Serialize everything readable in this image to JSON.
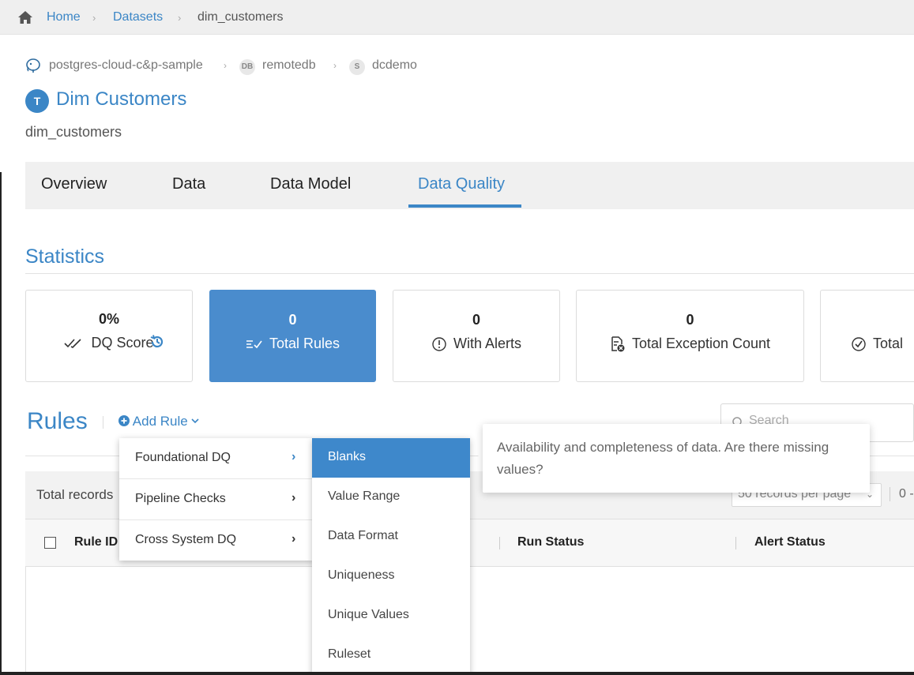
{
  "breadcrumb": {
    "home": "Home",
    "datasets": "Datasets",
    "current": "dim_customers"
  },
  "source": {
    "connection": "postgres-cloud-c&p-sample",
    "db_badge": "DB",
    "database": "remotedb",
    "schema_badge": "S",
    "schema": "dcdemo"
  },
  "table": {
    "avatar": "T",
    "title": "Dim Customers",
    "name": "dim_customers"
  },
  "tabs": [
    "Overview",
    "Data",
    "Data Model",
    "Data Quality"
  ],
  "active_tab": "Data Quality",
  "statistics": {
    "title": "Statistics",
    "cards": [
      {
        "value": "0%",
        "label": "DQ Score",
        "icon": "double-check-icon"
      },
      {
        "value": "0",
        "label": "Total Rules",
        "icon": "rules-list-icon"
      },
      {
        "value": "0",
        "label": "With Alerts",
        "icon": "alert-circle-icon"
      },
      {
        "value": "0",
        "label": "Total Exception Count",
        "icon": "file-exception-icon"
      },
      {
        "value": "",
        "label": "Total",
        "icon": "check-circle-icon"
      }
    ]
  },
  "rules": {
    "title": "Rules",
    "add_rule": "Add Rule",
    "search_placeholder": "Search",
    "total_records": "Total records",
    "per_page": "50 records per page",
    "pager": "0 -",
    "columns": [
      "Rule ID",
      "Run Status",
      "Alert Status"
    ]
  },
  "menu": {
    "categories": [
      "Foundational DQ",
      "Pipeline Checks",
      "Cross System DQ"
    ],
    "subitems": [
      "Blanks",
      "Value Range",
      "Data Format",
      "Uniqueness",
      "Unique Values",
      "Ruleset"
    ],
    "tooltip": "Availability and completeness of data. Are there missing values?"
  },
  "colors": {
    "accent": "#3b86c6",
    "active_card": "#4a8ccd"
  }
}
